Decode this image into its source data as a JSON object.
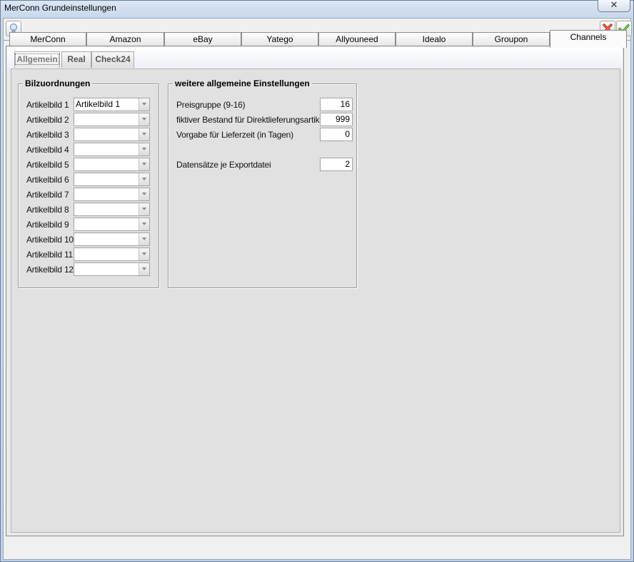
{
  "window": {
    "title": "MerConn Grundeinstellungen",
    "close_glyph": "✕"
  },
  "toolbar": {
    "hint_icon": "lightbulb-icon",
    "cancel_icon": "red-x-icon",
    "ok_icon": "green-check-icon"
  },
  "tabs": [
    {
      "label": "MerConn",
      "active": false
    },
    {
      "label": "Amazon",
      "active": false
    },
    {
      "label": "eBay",
      "active": false
    },
    {
      "label": "Yatego",
      "active": false
    },
    {
      "label": "Allyouneed",
      "active": false
    },
    {
      "label": "Idealo",
      "active": false
    },
    {
      "label": "Groupon",
      "active": false
    },
    {
      "label": "Channels",
      "active": true
    }
  ],
  "subtabs": [
    {
      "label": "Allgemein",
      "active": true
    },
    {
      "label": "Real",
      "active": false
    },
    {
      "label": "Check24",
      "active": false
    }
  ],
  "bildzuordnungen": {
    "title": "Bilzuordnungen",
    "rows": [
      {
        "label": "Artikelbild 1",
        "value": "Artikelbild 1"
      },
      {
        "label": "Artikelbild 2",
        "value": ""
      },
      {
        "label": "Artikelbild 3",
        "value": ""
      },
      {
        "label": "Artikelbild 4",
        "value": ""
      },
      {
        "label": "Artikelbild 5",
        "value": ""
      },
      {
        "label": "Artikelbild 6",
        "value": ""
      },
      {
        "label": "Artikelbild 7",
        "value": ""
      },
      {
        "label": "Artikelbild 8",
        "value": ""
      },
      {
        "label": "Artikelbild 9",
        "value": ""
      },
      {
        "label": "Artikelbild 10",
        "value": ""
      },
      {
        "label": "Artikelbild 11",
        "value": ""
      },
      {
        "label": "Artikelbild 12",
        "value": ""
      }
    ]
  },
  "weitere": {
    "title": "weitere allgemeine Einstellungen",
    "fields": [
      {
        "label": "Preisgruppe (9-16)",
        "value": "16"
      },
      {
        "label": "fiktiver Bestand für Direktlieferungsartikel",
        "value": "999"
      },
      {
        "label": "Vorgabe für Lieferzeit (in Tagen)",
        "value": "0"
      },
      {
        "label": "Datensätze je Exportdatei",
        "value": "2"
      }
    ]
  },
  "colors": {
    "cancel": "#d6281c",
    "ok": "#3f9a1a"
  }
}
